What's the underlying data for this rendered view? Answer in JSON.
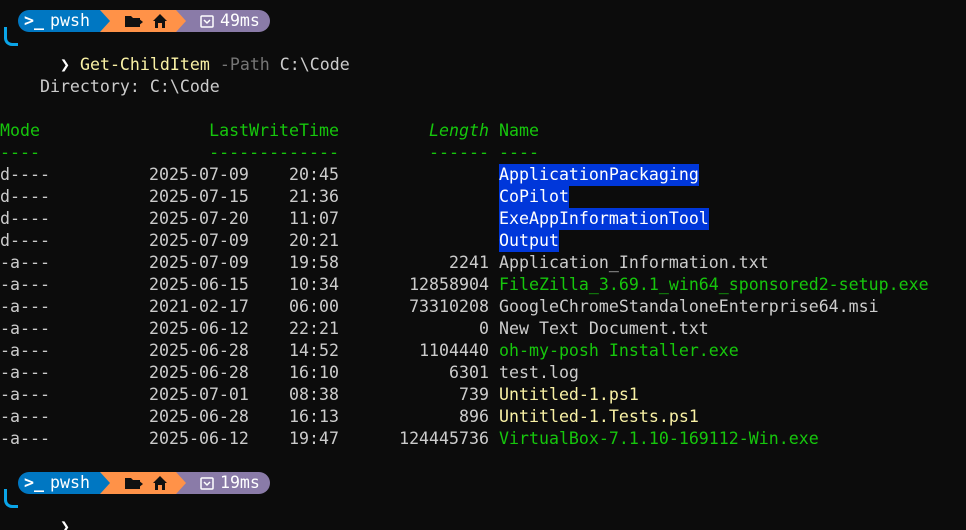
{
  "prompts": [
    {
      "shell": "pwsh",
      "duration": "49ms",
      "command": {
        "name": "Get-ChildItem",
        "param": "-Path",
        "arg": "C:\\Code"
      }
    },
    {
      "shell": "pwsh",
      "duration": "19ms"
    }
  ],
  "icons": {
    "shell": "terminal-prompt-icon",
    "folder": "folder-arrow-icon",
    "home": "home-icon",
    "timer": "stopwatch-icon"
  },
  "directory_header": "    Directory: C:\\Code",
  "columns": {
    "mode": "Mode",
    "lastwritetime": "LastWriteTime",
    "length": "Length",
    "name": "Name",
    "mode_ul": "----",
    "lastwritetime_ul": "-------------",
    "length_ul": "------",
    "name_ul": "----"
  },
  "rows": [
    {
      "mode": "d----",
      "date": "2025-07-09",
      "time": "20:45",
      "length": "",
      "name": "ApplicationPackaging",
      "kind": "dir"
    },
    {
      "mode": "d----",
      "date": "2025-07-15",
      "time": "21:36",
      "length": "",
      "name": "CoPilot",
      "kind": "dir"
    },
    {
      "mode": "d----",
      "date": "2025-07-20",
      "time": "11:07",
      "length": "",
      "name": "ExeAppInformationTool",
      "kind": "dir"
    },
    {
      "mode": "d----",
      "date": "2025-07-09",
      "time": "20:21",
      "length": "",
      "name": "Output",
      "kind": "dir"
    },
    {
      "mode": "-a---",
      "date": "2025-07-09",
      "time": "19:58",
      "length": "2241",
      "name": "Application_Information.txt",
      "kind": "file"
    },
    {
      "mode": "-a---",
      "date": "2025-06-15",
      "time": "10:34",
      "length": "12858904",
      "name": "FileZilla_3.69.1_win64_sponsored2-setup.exe",
      "kind": "exe"
    },
    {
      "mode": "-a---",
      "date": "2021-02-17",
      "time": "06:00",
      "length": "73310208",
      "name": "GoogleChromeStandaloneEnterprise64.msi",
      "kind": "file"
    },
    {
      "mode": "-a---",
      "date": "2025-06-12",
      "time": "22:21",
      "length": "0",
      "name": "New Text Document.txt",
      "kind": "file"
    },
    {
      "mode": "-a---",
      "date": "2025-06-28",
      "time": "14:52",
      "length": "1104440",
      "name": "oh-my-posh Installer.exe",
      "kind": "exe"
    },
    {
      "mode": "-a---",
      "date": "2025-06-28",
      "time": "16:10",
      "length": "6301",
      "name": "test.log",
      "kind": "file"
    },
    {
      "mode": "-a---",
      "date": "2025-07-01",
      "time": "08:38",
      "length": "739",
      "name": "Untitled-1.ps1",
      "kind": "script"
    },
    {
      "mode": "-a---",
      "date": "2025-06-28",
      "time": "16:13",
      "length": "896",
      "name": "Untitled-1.Tests.ps1",
      "kind": "script"
    },
    {
      "mode": "-a---",
      "date": "2025-06-12",
      "time": "19:47",
      "length": "124445736",
      "name": "VirtualBox-7.1.10-169112-Win.exe",
      "kind": "exe"
    }
  ],
  "colors": {
    "background": "#0c0c0c",
    "foreground": "#cccccc",
    "shell_segment": "#0077c2",
    "path_segment": "#ff9248",
    "time_segment": "#8a7ba8",
    "command": "#f9f1a5",
    "parameter": "#767676",
    "header": "#16c60c",
    "directory_highlight": "#0037da",
    "executable": "#16c60c",
    "script": "#f9f1a5"
  }
}
